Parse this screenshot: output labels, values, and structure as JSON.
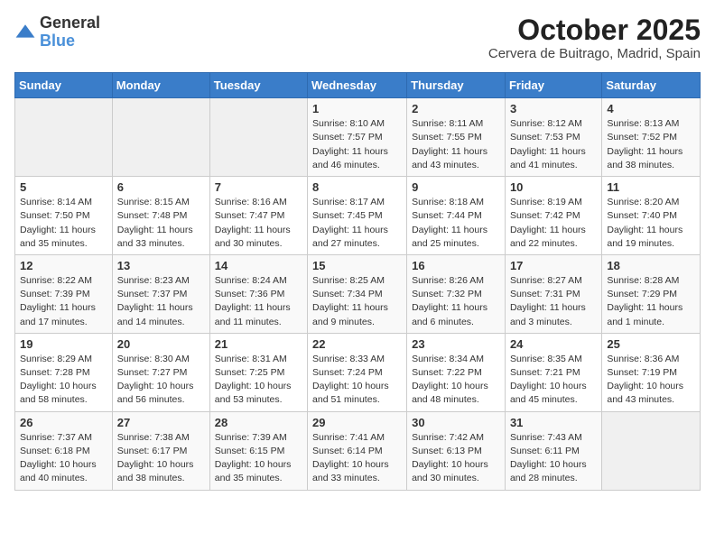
{
  "logo": {
    "general": "General",
    "blue": "Blue"
  },
  "title": "October 2025",
  "location": "Cervera de Buitrago, Madrid, Spain",
  "days_of_week": [
    "Sunday",
    "Monday",
    "Tuesday",
    "Wednesday",
    "Thursday",
    "Friday",
    "Saturday"
  ],
  "weeks": [
    [
      {
        "day": "",
        "info": ""
      },
      {
        "day": "",
        "info": ""
      },
      {
        "day": "",
        "info": ""
      },
      {
        "day": "1",
        "info": "Sunrise: 8:10 AM\nSunset: 7:57 PM\nDaylight: 11 hours and 46 minutes."
      },
      {
        "day": "2",
        "info": "Sunrise: 8:11 AM\nSunset: 7:55 PM\nDaylight: 11 hours and 43 minutes."
      },
      {
        "day": "3",
        "info": "Sunrise: 8:12 AM\nSunset: 7:53 PM\nDaylight: 11 hours and 41 minutes."
      },
      {
        "day": "4",
        "info": "Sunrise: 8:13 AM\nSunset: 7:52 PM\nDaylight: 11 hours and 38 minutes."
      }
    ],
    [
      {
        "day": "5",
        "info": "Sunrise: 8:14 AM\nSunset: 7:50 PM\nDaylight: 11 hours and 35 minutes."
      },
      {
        "day": "6",
        "info": "Sunrise: 8:15 AM\nSunset: 7:48 PM\nDaylight: 11 hours and 33 minutes."
      },
      {
        "day": "7",
        "info": "Sunrise: 8:16 AM\nSunset: 7:47 PM\nDaylight: 11 hours and 30 minutes."
      },
      {
        "day": "8",
        "info": "Sunrise: 8:17 AM\nSunset: 7:45 PM\nDaylight: 11 hours and 27 minutes."
      },
      {
        "day": "9",
        "info": "Sunrise: 8:18 AM\nSunset: 7:44 PM\nDaylight: 11 hours and 25 minutes."
      },
      {
        "day": "10",
        "info": "Sunrise: 8:19 AM\nSunset: 7:42 PM\nDaylight: 11 hours and 22 minutes."
      },
      {
        "day": "11",
        "info": "Sunrise: 8:20 AM\nSunset: 7:40 PM\nDaylight: 11 hours and 19 minutes."
      }
    ],
    [
      {
        "day": "12",
        "info": "Sunrise: 8:22 AM\nSunset: 7:39 PM\nDaylight: 11 hours and 17 minutes."
      },
      {
        "day": "13",
        "info": "Sunrise: 8:23 AM\nSunset: 7:37 PM\nDaylight: 11 hours and 14 minutes."
      },
      {
        "day": "14",
        "info": "Sunrise: 8:24 AM\nSunset: 7:36 PM\nDaylight: 11 hours and 11 minutes."
      },
      {
        "day": "15",
        "info": "Sunrise: 8:25 AM\nSunset: 7:34 PM\nDaylight: 11 hours and 9 minutes."
      },
      {
        "day": "16",
        "info": "Sunrise: 8:26 AM\nSunset: 7:32 PM\nDaylight: 11 hours and 6 minutes."
      },
      {
        "day": "17",
        "info": "Sunrise: 8:27 AM\nSunset: 7:31 PM\nDaylight: 11 hours and 3 minutes."
      },
      {
        "day": "18",
        "info": "Sunrise: 8:28 AM\nSunset: 7:29 PM\nDaylight: 11 hours and 1 minute."
      }
    ],
    [
      {
        "day": "19",
        "info": "Sunrise: 8:29 AM\nSunset: 7:28 PM\nDaylight: 10 hours and 58 minutes."
      },
      {
        "day": "20",
        "info": "Sunrise: 8:30 AM\nSunset: 7:27 PM\nDaylight: 10 hours and 56 minutes."
      },
      {
        "day": "21",
        "info": "Sunrise: 8:31 AM\nSunset: 7:25 PM\nDaylight: 10 hours and 53 minutes."
      },
      {
        "day": "22",
        "info": "Sunrise: 8:33 AM\nSunset: 7:24 PM\nDaylight: 10 hours and 51 minutes."
      },
      {
        "day": "23",
        "info": "Sunrise: 8:34 AM\nSunset: 7:22 PM\nDaylight: 10 hours and 48 minutes."
      },
      {
        "day": "24",
        "info": "Sunrise: 8:35 AM\nSunset: 7:21 PM\nDaylight: 10 hours and 45 minutes."
      },
      {
        "day": "25",
        "info": "Sunrise: 8:36 AM\nSunset: 7:19 PM\nDaylight: 10 hours and 43 minutes."
      }
    ],
    [
      {
        "day": "26",
        "info": "Sunrise: 7:37 AM\nSunset: 6:18 PM\nDaylight: 10 hours and 40 minutes."
      },
      {
        "day": "27",
        "info": "Sunrise: 7:38 AM\nSunset: 6:17 PM\nDaylight: 10 hours and 38 minutes."
      },
      {
        "day": "28",
        "info": "Sunrise: 7:39 AM\nSunset: 6:15 PM\nDaylight: 10 hours and 35 minutes."
      },
      {
        "day": "29",
        "info": "Sunrise: 7:41 AM\nSunset: 6:14 PM\nDaylight: 10 hours and 33 minutes."
      },
      {
        "day": "30",
        "info": "Sunrise: 7:42 AM\nSunset: 6:13 PM\nDaylight: 10 hours and 30 minutes."
      },
      {
        "day": "31",
        "info": "Sunrise: 7:43 AM\nSunset: 6:11 PM\nDaylight: 10 hours and 28 minutes."
      },
      {
        "day": "",
        "info": ""
      }
    ]
  ]
}
